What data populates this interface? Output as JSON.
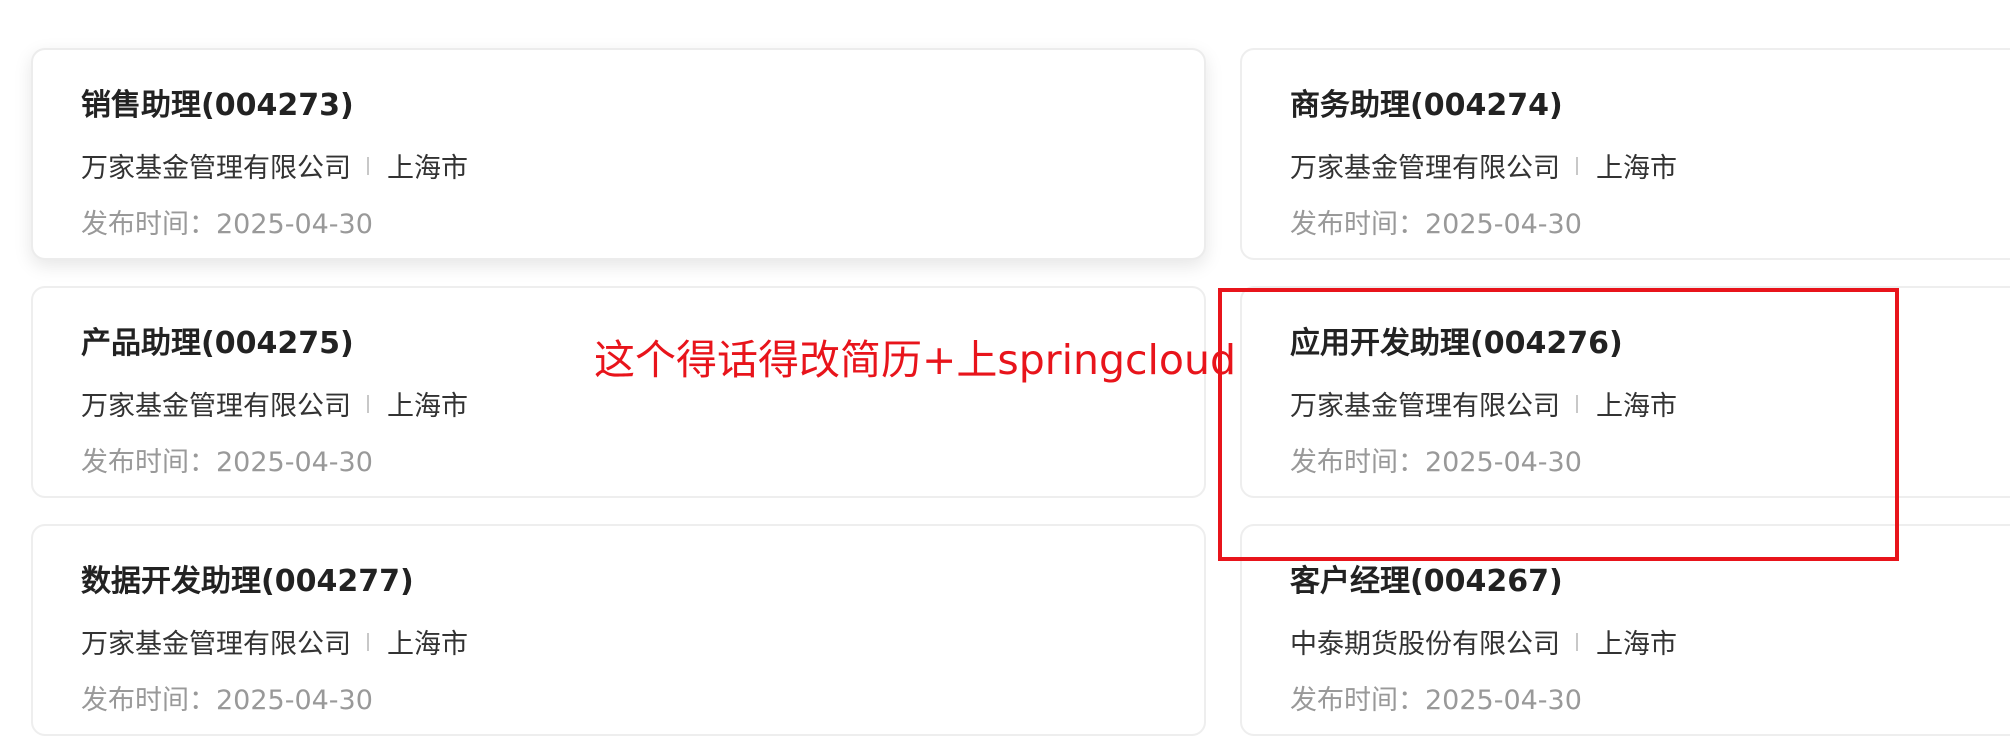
{
  "jobs": [
    {
      "title": "销售助理(004273)",
      "company": "万家基金管理有限公司",
      "city": "上海市",
      "publish_label": "发布时间：",
      "publish_date": "2025-04-30"
    },
    {
      "title": "商务助理(004274)",
      "company": "万家基金管理有限公司",
      "city": "上海市",
      "publish_label": "发布时间：",
      "publish_date": "2025-04-30"
    },
    {
      "title": "产品助理(004275)",
      "company": "万家基金管理有限公司",
      "city": "上海市",
      "publish_label": "发布时间：",
      "publish_date": "2025-04-30"
    },
    {
      "title": "应用开发助理(004276)",
      "company": "万家基金管理有限公司",
      "city": "上海市",
      "publish_label": "发布时间：",
      "publish_date": "2025-04-30"
    },
    {
      "title": "数据开发助理(004277)",
      "company": "万家基金管理有限公司",
      "city": "上海市",
      "publish_label": "发布时间：",
      "publish_date": "2025-04-30"
    },
    {
      "title": "客户经理(004267)",
      "company": "中泰期货股份有限公司",
      "city": "上海市",
      "publish_label": "发布时间：",
      "publish_date": "2025-04-30"
    }
  ],
  "annotation": {
    "text": "这个得话得改简历+上springcloud",
    "color": "#e8141b"
  }
}
